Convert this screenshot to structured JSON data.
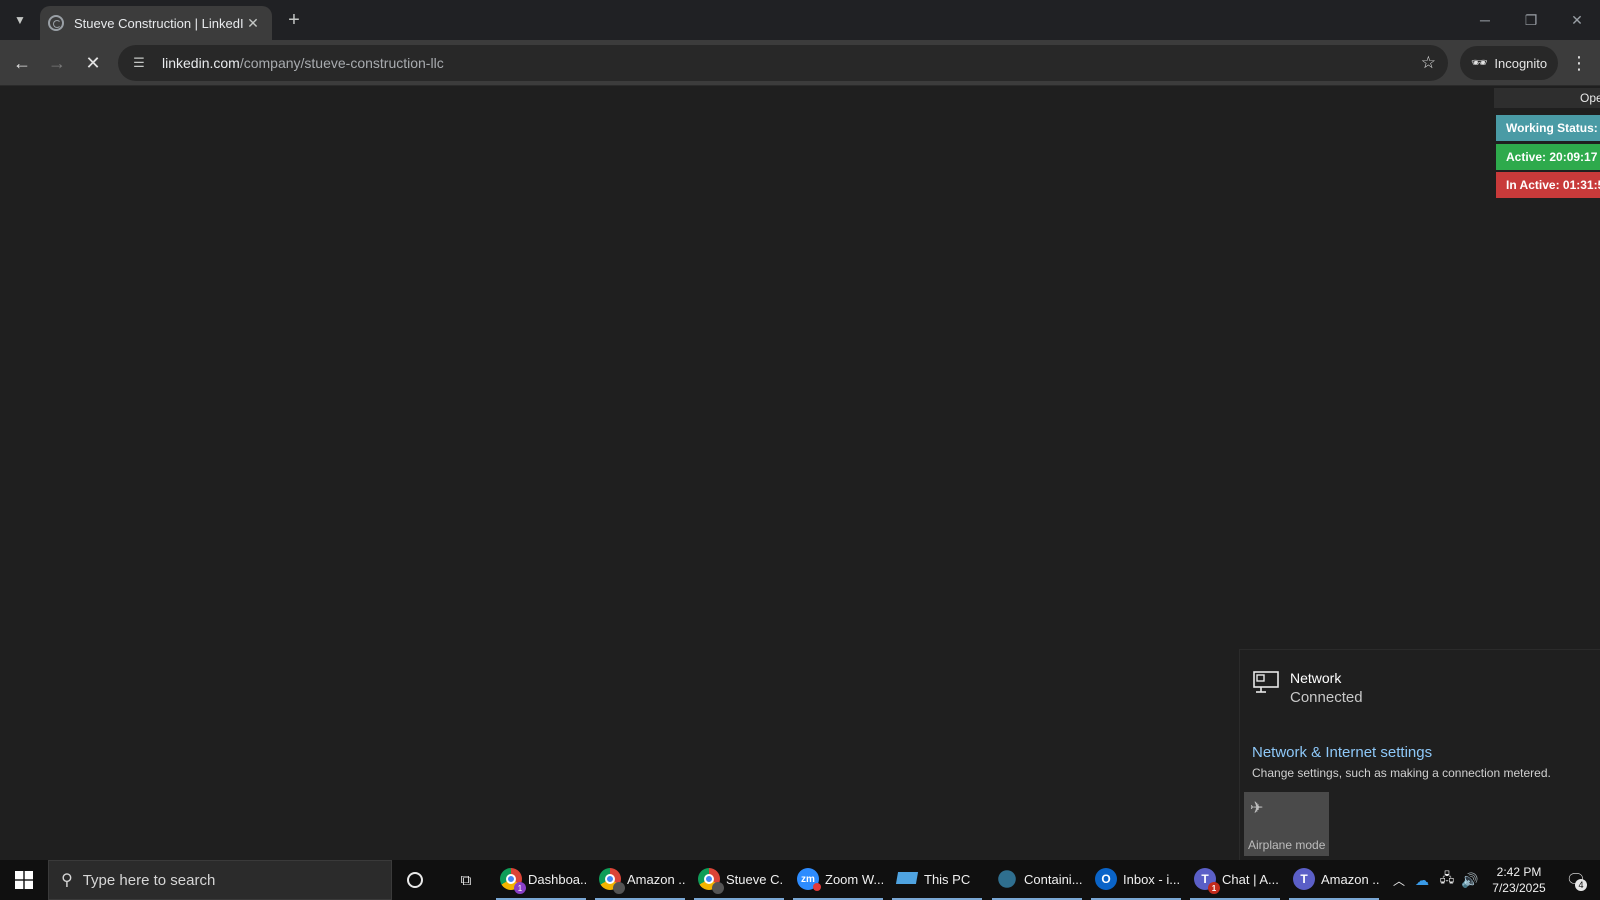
{
  "browser": {
    "tab": {
      "title": "Stueve Construction | LinkedIn",
      "close_glyph": "✕"
    },
    "new_tab_glyph": "+",
    "window_controls": {
      "minimize": "─",
      "restore": "❐",
      "close": "✕"
    },
    "url": {
      "host": "linkedin.com",
      "path": "/company/stueve-construction-llc"
    },
    "incognito_label": "Incognito"
  },
  "extension_overlay": {
    "open_label": "Open",
    "working_status": "Working Status: A",
    "active": "Active: 20:09:17",
    "inactive": "In Active: 01:31:5"
  },
  "network_flyout": {
    "network_name": "Network",
    "network_status": "Connected",
    "settings_link": "Network & Internet settings",
    "settings_description": "Change settings, such as making a connection metered.",
    "airplane_label": "Airplane mode"
  },
  "taskbar": {
    "search_placeholder": "Type here to search",
    "apps": [
      {
        "label": "Dashboa...",
        "icon": "chrome-icon",
        "badge": "1",
        "badge_color": "#8a3fc7"
      },
      {
        "label": "Amazon ...",
        "icon": "chrome-icon",
        "badge": "",
        "badge_color": "#555555"
      },
      {
        "label": "Stueve C...",
        "icon": "chrome-icon",
        "badge": "",
        "badge_color": "#555555"
      },
      {
        "label": "Zoom W...",
        "icon": "zoom-icon",
        "badge": "",
        "badge_color": "#e23a3a"
      },
      {
        "label": "This PC",
        "icon": "this-pc-icon"
      },
      {
        "label": "Containi...",
        "icon": "container-icon"
      },
      {
        "label": "Inbox - i...",
        "icon": "outlook-icon"
      },
      {
        "label": "Chat | A...",
        "icon": "teams-icon",
        "badge": "1",
        "badge_color": "#c42b1c"
      },
      {
        "label": "Amazon ...",
        "icon": "teams-icon"
      }
    ],
    "clock": {
      "time": "2:42 PM",
      "date": "7/23/2025"
    },
    "notification_count": "4"
  },
  "colors": {
    "accent_link": "#8ec8f8",
    "working": "#4a9ba5",
    "active": "#2eaa4c",
    "inactive": "#c83a3a"
  }
}
